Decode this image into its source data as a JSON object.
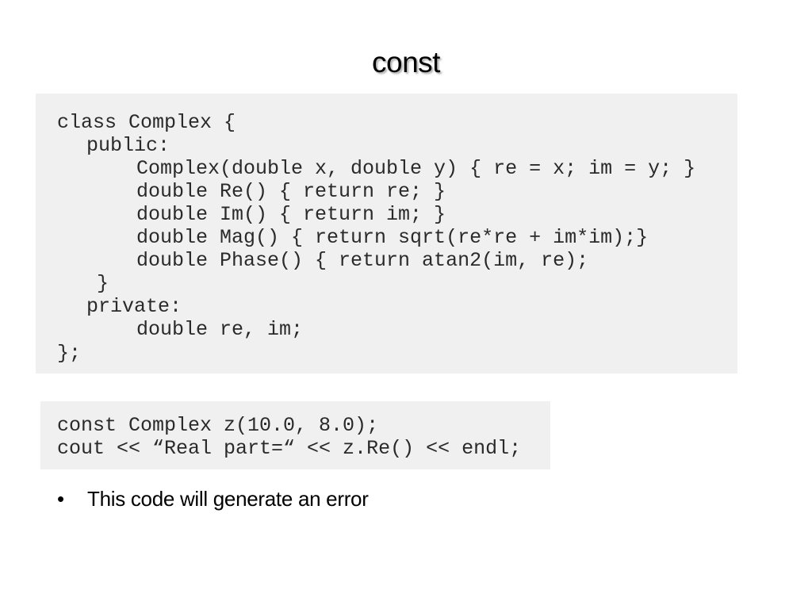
{
  "slide": {
    "title": "const",
    "class_code": [
      "class Complex {",
      "public:",
      "Complex(double x, double y) { re = x; im = y; }",
      "double Re() { return re; }",
      "double Im() { return im; }",
      "double Mag() { return sqrt(re*re + im*im);}",
      "double Phase() { return atan2(im, re);",
      "}",
      "private:",
      "double re, im;",
      "};"
    ],
    "usage_code": [
      "const Complex z(10.0, 8.0);",
      "cout << “Real part=“ << z.Re() << endl;"
    ],
    "bullets": [
      "This code will generate an error"
    ],
    "bullet_symbol": "•"
  }
}
